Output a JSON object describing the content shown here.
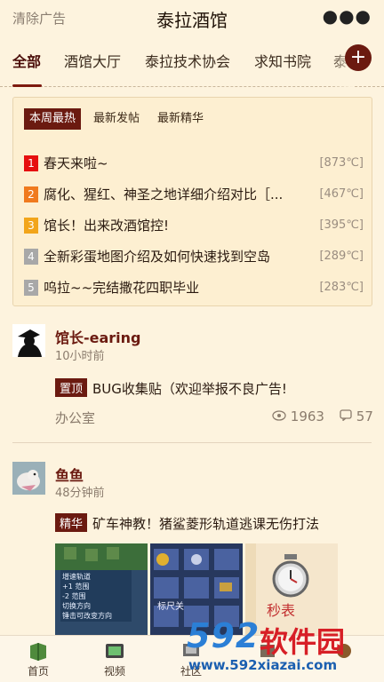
{
  "topbar": {
    "clear_ads": "清除广告",
    "title": "泰拉酒馆",
    "more_icon": "more-dots-icon"
  },
  "tabs": {
    "items": [
      "全部",
      "酒馆大厅",
      "泰拉技术协会",
      "求知书院",
      "泰"
    ],
    "active_index": 0,
    "add_icon": "plus-icon"
  },
  "hot": {
    "tabs": [
      "本周最热",
      "最新发帖",
      "最新精华"
    ],
    "active_tab": 0,
    "items": [
      {
        "rank": "1",
        "title": "春天来啦~",
        "heat": "[873℃]",
        "color": "#e60f0f"
      },
      {
        "rank": "2",
        "title": "腐化、猩红、神圣之地详细介绍对比［...",
        "heat": "[467℃]",
        "color": "#f07a1e"
      },
      {
        "rank": "3",
        "title": "馆长！出来改酒馆控!",
        "heat": "[395℃]",
        "color": "#f2a51a"
      },
      {
        "rank": "4",
        "title": "全新彩蛋地图介绍及如何快速找到空岛",
        "heat": "[289℃]",
        "color": "#a8a8a8"
      },
      {
        "rank": "5",
        "title": "呜拉~~完结撒花四职毕业",
        "heat": "[283℃]",
        "color": "#a8a8a8"
      }
    ]
  },
  "posts": [
    {
      "author": "馆长-earing",
      "time": "10小时前",
      "badge": "置顶",
      "title": "BUG收集贴（欢迎举报不良广告!",
      "board": "办公室",
      "views": "1963",
      "comments": "57"
    },
    {
      "author": "鱼鱼",
      "time": "48分钟前",
      "badge": "精华",
      "title": "矿车神教！猪鲨菱形轨道逃课无伤打法",
      "thumb1_lines": [
        "增速轨道",
        "+1 范围",
        "-2 范围",
        "切换方向",
        "锤击可改变方向"
      ],
      "thumb2_label": "标尺关",
      "thumb3_label": "秒表"
    }
  ],
  "bottom_nav": [
    {
      "label": "首页",
      "icon": "book-icon"
    },
    {
      "label": "视频",
      "icon": "tv-icon"
    },
    {
      "label": "社区",
      "icon": "community-icon"
    },
    {
      "label": "",
      "icon": "link-icon"
    },
    {
      "label": "",
      "icon": "profile-icon"
    }
  ],
  "watermark": {
    "brand_num": "592",
    "brand_text": "软件园",
    "url": "www.592xiazai.com"
  },
  "colors": {
    "accent": "#6b1a10",
    "background": "#fdf3de",
    "hot_box": "#fdefd1"
  }
}
